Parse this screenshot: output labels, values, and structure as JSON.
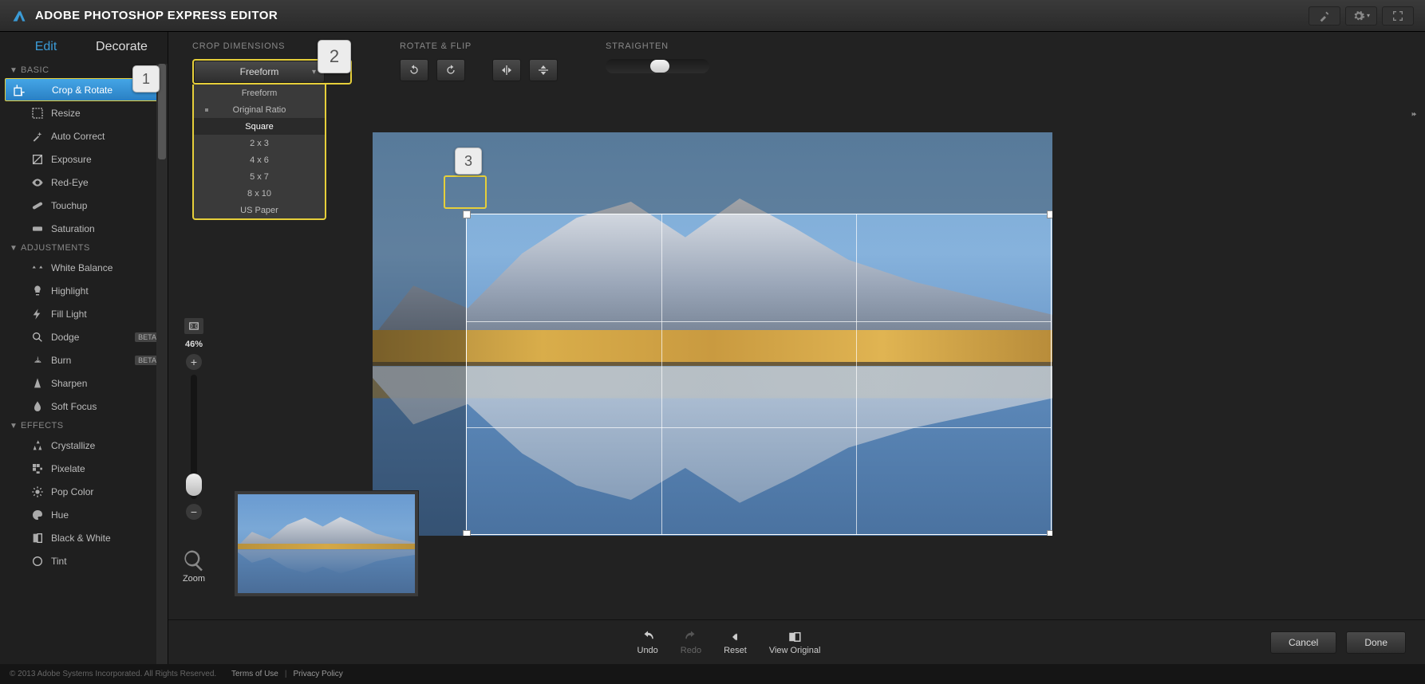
{
  "header": {
    "title": "ADOBE PHOTOSHOP EXPRESS EDITOR"
  },
  "sidebar": {
    "tabs": {
      "edit": "Edit",
      "decorate": "Decorate"
    },
    "groups": [
      {
        "name": "BASIC",
        "items": [
          {
            "label": "Crop & Rotate",
            "icon": "crop",
            "selected": true
          },
          {
            "label": "Resize",
            "icon": "resize"
          },
          {
            "label": "Auto Correct",
            "icon": "wand"
          },
          {
            "label": "Exposure",
            "icon": "exposure"
          },
          {
            "label": "Red-Eye",
            "icon": "eye"
          },
          {
            "label": "Touchup",
            "icon": "bandaid"
          },
          {
            "label": "Saturation",
            "icon": "saturation"
          }
        ]
      },
      {
        "name": "ADJUSTMENTS",
        "items": [
          {
            "label": "White Balance",
            "icon": "balance"
          },
          {
            "label": "Highlight",
            "icon": "bulb"
          },
          {
            "label": "Fill Light",
            "icon": "flash"
          },
          {
            "label": "Dodge",
            "icon": "dodge",
            "beta": true
          },
          {
            "label": "Burn",
            "icon": "burn",
            "beta": true
          },
          {
            "label": "Sharpen",
            "icon": "sharpen"
          },
          {
            "label": "Soft Focus",
            "icon": "drop"
          }
        ]
      },
      {
        "name": "EFFECTS",
        "items": [
          {
            "label": "Crystallize",
            "icon": "crystallize"
          },
          {
            "label": "Pixelate",
            "icon": "pixelate"
          },
          {
            "label": "Pop Color",
            "icon": "pop"
          },
          {
            "label": "Hue",
            "icon": "palette"
          },
          {
            "label": "Black & White",
            "icon": "bw"
          },
          {
            "label": "Tint",
            "icon": "tint"
          }
        ]
      }
    ]
  },
  "options": {
    "crop_title": "CROP DIMENSIONS",
    "crop_selected": "Freeform",
    "crop_items": [
      "Freeform",
      "Original Ratio",
      "Square",
      "2 x 3",
      "4 x 6",
      "5 x 7",
      "8 x 10",
      "US Paper"
    ],
    "crop_current_index": 1,
    "crop_hover_index": 2,
    "rotate_title": "ROTATE & FLIP",
    "straighten_title": "STRAIGHTEN"
  },
  "zoom": {
    "value": "46%",
    "label": "Zoom"
  },
  "bottombar": {
    "undo": "Undo",
    "redo": "Redo",
    "reset": "Reset",
    "view_original": "View Original",
    "cancel": "Cancel",
    "done": "Done"
  },
  "footer": {
    "copyright": "© 2013 Adobe Systems Incorporated. All Rights Reserved.",
    "terms": "Terms of Use",
    "privacy": "Privacy Policy"
  },
  "callouts": {
    "c1": "1",
    "c2": "2",
    "c3": "3"
  },
  "beta_label": "BETA"
}
